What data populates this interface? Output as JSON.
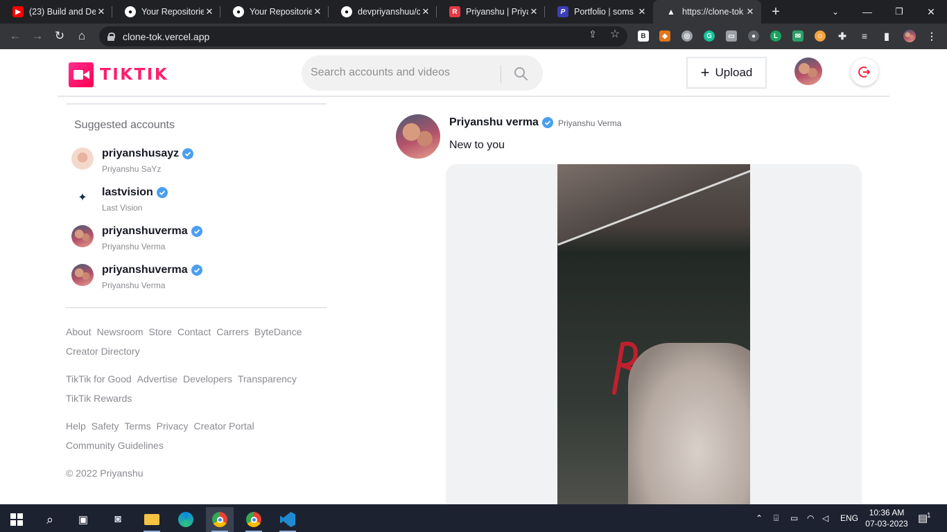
{
  "browser": {
    "tabs": [
      {
        "title": "(23) Build and De",
        "fav": "youtube-icon",
        "color": "#ff0000"
      },
      {
        "title": "Your Repositories",
        "fav": "github-icon",
        "color": "#ffffff"
      },
      {
        "title": "Your Repositories",
        "fav": "github-icon",
        "color": "#ffffff"
      },
      {
        "title": "devpriyanshuu/cl",
        "fav": "github-icon",
        "color": "#ffffff"
      },
      {
        "title": "Priyanshu | Priyan",
        "fav": "portfolio-icon",
        "color": "#e53945"
      },
      {
        "title": "Portfolio | soms",
        "fav": "p-icon",
        "color": "#3b3fb6"
      },
      {
        "title": "https://clone-tok",
        "fav": "vercel-icon",
        "color": "#000000"
      }
    ],
    "url": "clone-tok.vercel.app"
  },
  "header": {
    "logo_text": "TIKTIK",
    "search_placeholder": "Search accounts and videos",
    "upload_label": "Upload"
  },
  "sidebar": {
    "suggested_title": "Suggested accounts",
    "accounts": [
      {
        "username": "priyanshusayz",
        "display": "Priyanshu SaYz"
      },
      {
        "username": "lastvision",
        "display": "Last Vision"
      },
      {
        "username": "priyanshuverma",
        "display": "Priyanshu Verma"
      },
      {
        "username": "priyanshuverma",
        "display": "Priyanshu Verma"
      }
    ],
    "links_1": [
      "About",
      "Newsroom",
      "Store",
      "Contact",
      "Carrers",
      "ByteDance",
      "Creator Directory"
    ],
    "links_2": [
      "TikTik for Good",
      "Advertise",
      "Developers",
      "Transparency",
      "TikTik Rewards"
    ],
    "links_3": [
      "Help",
      "Safety",
      "Terms",
      "Privacy",
      "Creator Portal",
      "Community Guidelines"
    ],
    "copyright": "© 2022 Priyanshu"
  },
  "post": {
    "name": "Priyanshu verma",
    "handle": "Priyanshu Verma",
    "caption": "New to you"
  },
  "taskbar": {
    "lang": "ENG",
    "time": "10:36 AM",
    "date": "07-03-2023",
    "notif_count": "1"
  },
  "colors": {
    "brand": "#ff1f6e",
    "verified": "#20d5ec",
    "logout": "#ff1f3a"
  }
}
